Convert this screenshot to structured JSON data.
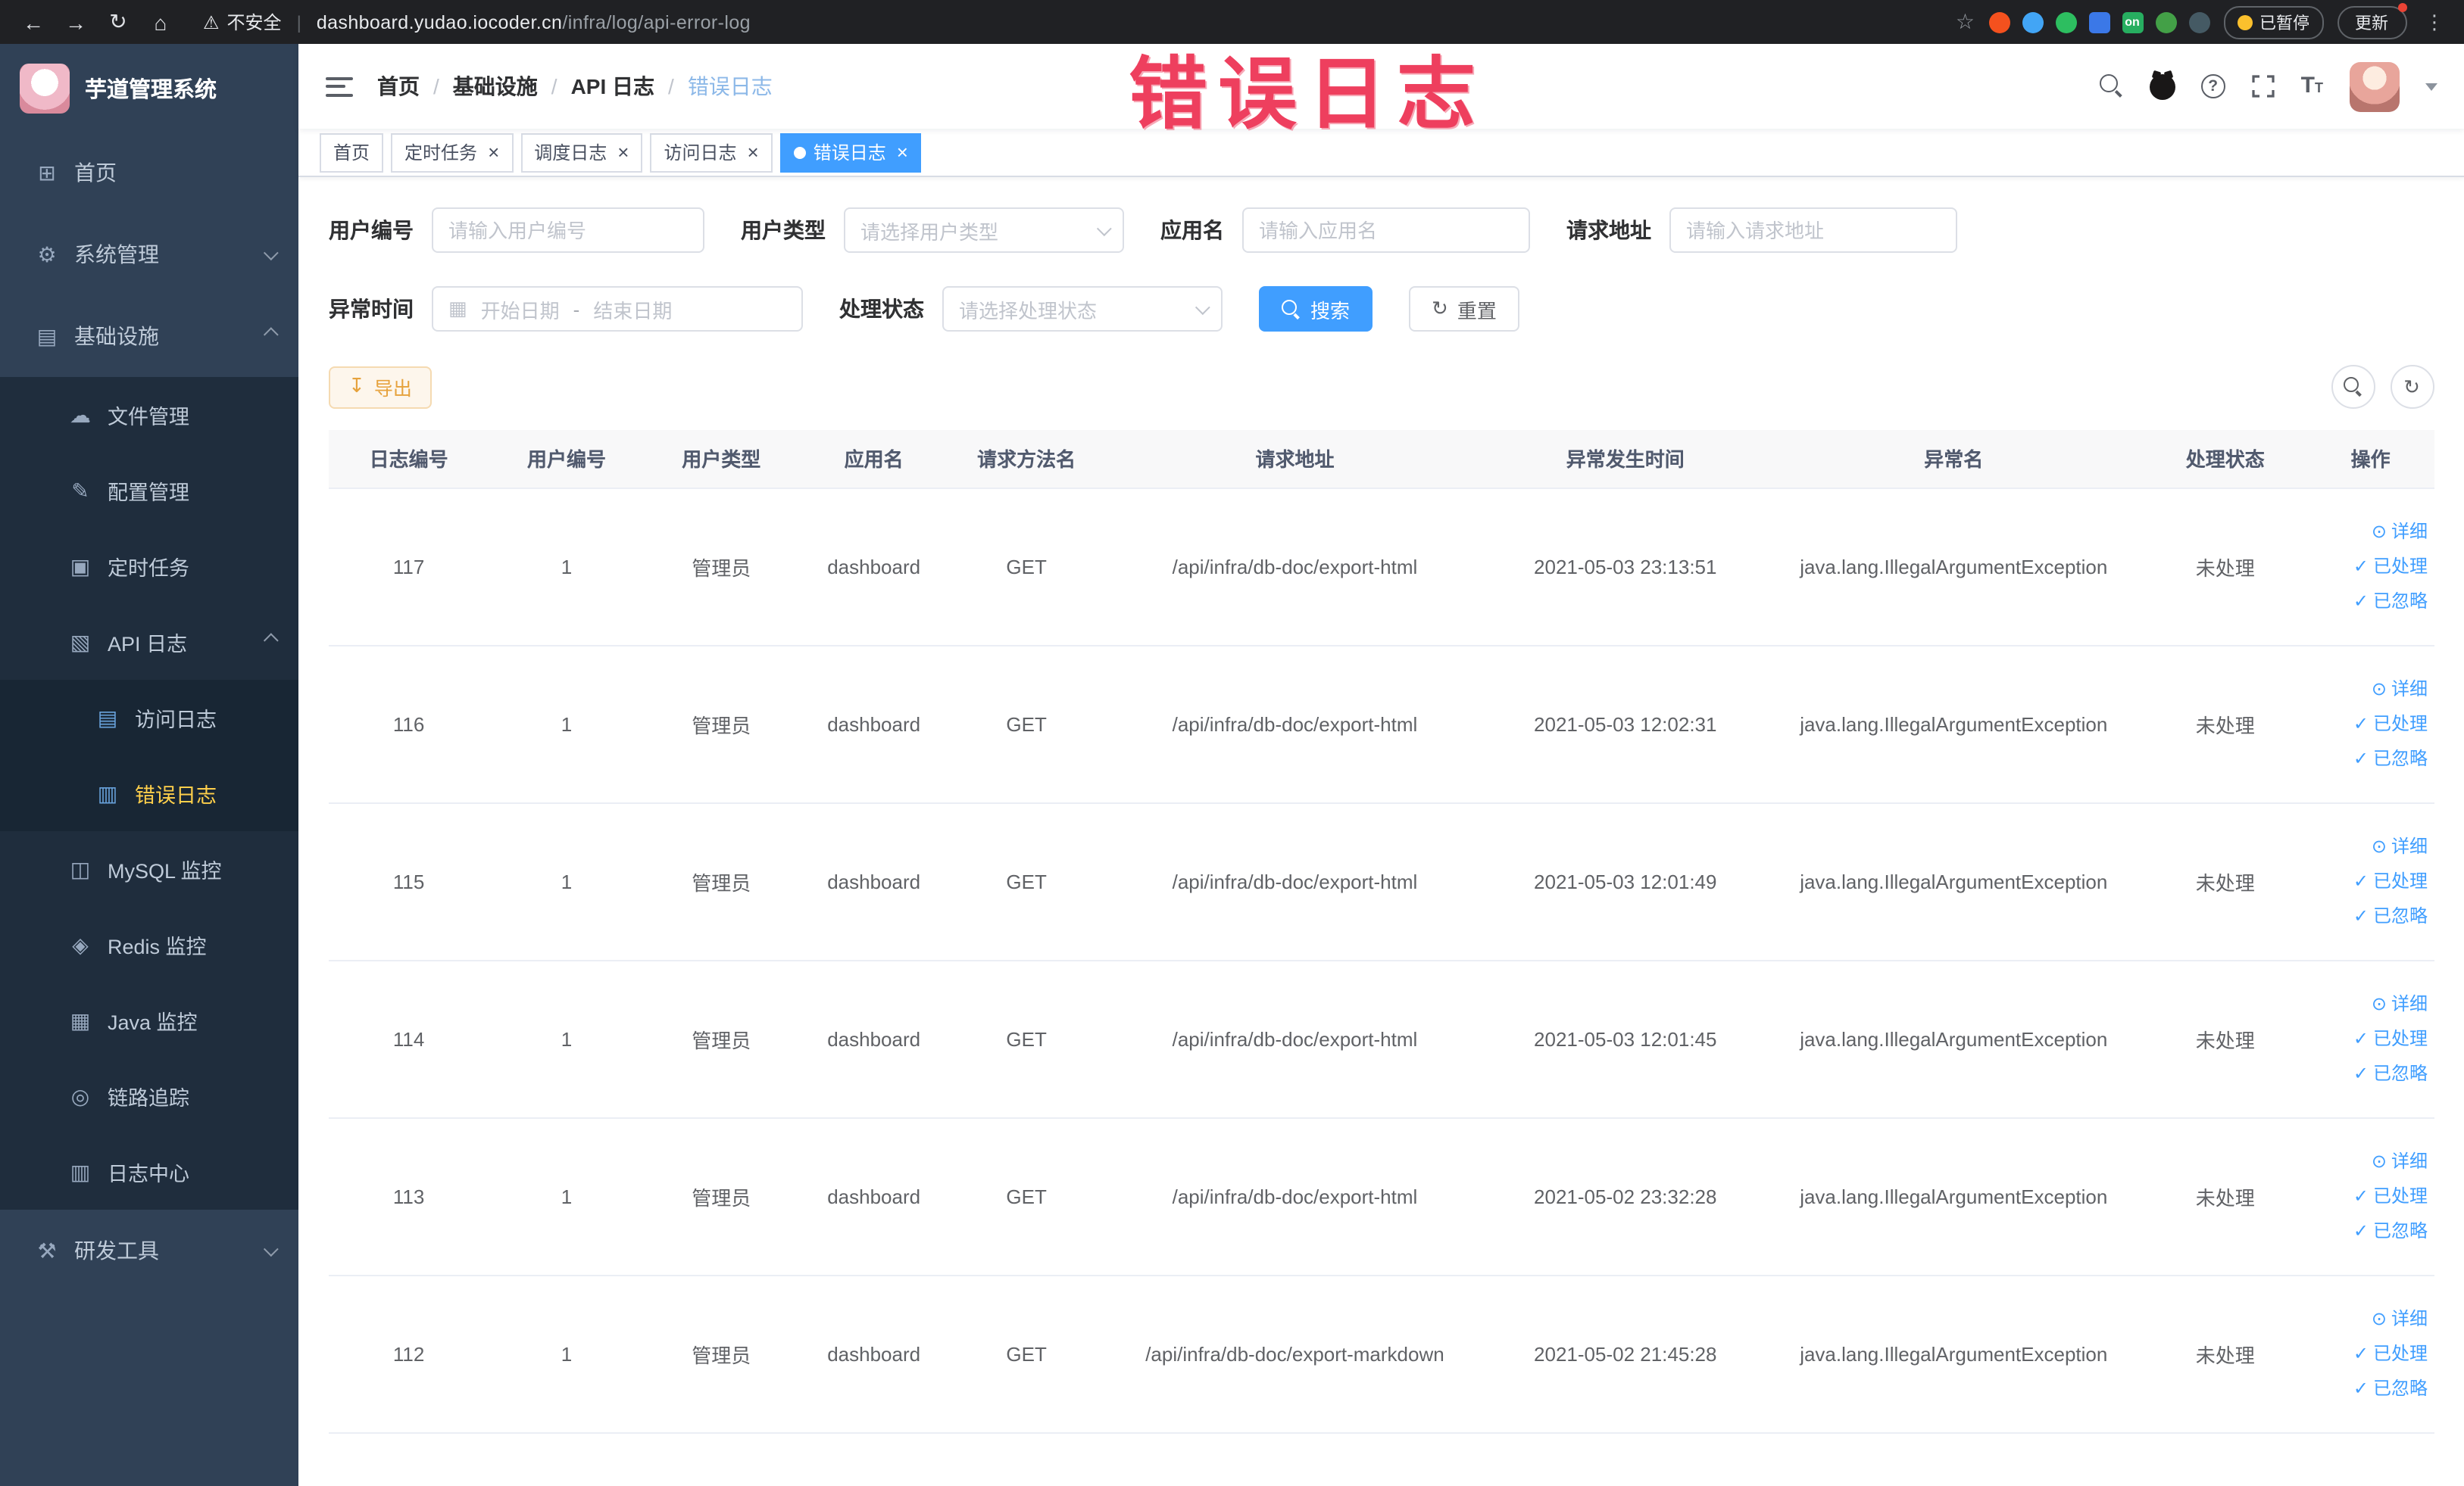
{
  "browser": {
    "icons": {
      "back": "←",
      "forward": "→",
      "reload": "↻",
      "home": "⌂",
      "bookmark": "☆",
      "warning": "⚠",
      "menu": "⋮"
    },
    "security_warning": "不安全",
    "url_domain": "dashboard.yudao.iocoder.cn",
    "url_path": "/infra/log/api-error-log",
    "extensions": [
      {
        "name": "extension-icon-orange-circle",
        "color": "#f4511e",
        "shape": "circle",
        "label": ""
      },
      {
        "name": "extension-icon-blue-drop",
        "color": "#42a5f5",
        "shape": "circle",
        "label": ""
      },
      {
        "name": "extension-icon-green-circle",
        "color": "#2dbe60",
        "shape": "circle",
        "label": ""
      },
      {
        "name": "extension-icon-blue-grid",
        "color": "#3b78e7",
        "shape": "square",
        "label": ""
      },
      {
        "name": "extension-icon-on-badge",
        "color": "#27ae60",
        "shape": "square",
        "label": "on"
      },
      {
        "name": "extension-icon-green-leaf",
        "color": "#43a047",
        "shape": "circle",
        "label": ""
      },
      {
        "name": "extension-icon-dark-paw",
        "color": "#455a64",
        "shape": "circle",
        "label": ""
      }
    ],
    "paused_badge": "已暂停",
    "update_button": "更新"
  },
  "overlay": {
    "watermark_text": "错误日志",
    "watermark_color": "#ee3f5e"
  },
  "sidebar": {
    "logo_title": "芋道管理系统",
    "items": [
      {
        "label": "首页",
        "icon": "home-icon",
        "glyph": "⊞",
        "level": 1,
        "chevron": "none",
        "active": false
      },
      {
        "label": "系统管理",
        "icon": "system-management-icon",
        "glyph": "⚙",
        "level": 1,
        "chevron": "down",
        "active": false
      },
      {
        "label": "基础设施",
        "icon": "infrastructure-icon",
        "glyph": "▤",
        "level": 1,
        "chevron": "up",
        "active": false
      },
      {
        "label": "文件管理",
        "icon": "file-management-icon",
        "glyph": "☁",
        "level": 2,
        "chevron": "none",
        "active": false
      },
      {
        "label": "配置管理",
        "icon": "config-management-icon",
        "glyph": "✎",
        "level": 2,
        "chevron": "none",
        "active": false
      },
      {
        "label": "定时任务",
        "icon": "scheduled-job-icon",
        "glyph": "▣",
        "level": 2,
        "chevron": "none",
        "active": false
      },
      {
        "label": "API 日志",
        "icon": "api-log-icon",
        "glyph": "▧",
        "level": 2,
        "chevron": "up",
        "active": false
      },
      {
        "label": "访问日志",
        "icon": "access-log-icon",
        "glyph": "▤",
        "level": 3,
        "chevron": "none",
        "active": false,
        "icon_color": "#69a3dc"
      },
      {
        "label": "错误日志",
        "icon": "error-log-icon",
        "glyph": "▥",
        "level": 3,
        "chevron": "none",
        "active": true,
        "icon_color": "#69a3dc"
      },
      {
        "label": "MySQL 监控",
        "icon": "mysql-monitor-icon",
        "glyph": "◫",
        "level": 2,
        "chevron": "none",
        "active": false
      },
      {
        "label": "Redis 监控",
        "icon": "redis-monitor-icon",
        "glyph": "◈",
        "level": 2,
        "chevron": "none",
        "active": false
      },
      {
        "label": "Java 监控",
        "icon": "java-monitor-icon",
        "glyph": "▦",
        "level": 2,
        "chevron": "none",
        "active": false
      },
      {
        "label": "链路追踪",
        "icon": "trace-icon",
        "glyph": "◎",
        "level": 2,
        "chevron": "none",
        "active": false
      },
      {
        "label": "日志中心",
        "icon": "log-center-icon",
        "glyph": "▥",
        "level": 2,
        "chevron": "none",
        "active": false
      },
      {
        "label": "研发工具",
        "icon": "dev-tools-icon",
        "glyph": "⚒",
        "level": 1,
        "chevron": "down",
        "active": false
      }
    ]
  },
  "breadcrumb": [
    "首页",
    "基础设施",
    "API 日志",
    "错误日志"
  ],
  "tabs": [
    {
      "label": "首页",
      "closable": false,
      "active": false
    },
    {
      "label": "定时任务",
      "closable": true,
      "active": false
    },
    {
      "label": "调度日志",
      "closable": true,
      "active": false
    },
    {
      "label": "访问日志",
      "closable": true,
      "active": false
    },
    {
      "label": "错误日志",
      "closable": true,
      "active": true
    }
  ],
  "tabs_close_glyph": "×",
  "filters": {
    "user_id": {
      "label": "用户编号",
      "placeholder": "请输入用户编号"
    },
    "user_type": {
      "label": "用户类型",
      "placeholder": "请选择用户类型"
    },
    "app_name": {
      "label": "应用名",
      "placeholder": "请输入应用名"
    },
    "request_url": {
      "label": "请求地址",
      "placeholder": "请输入请求地址"
    },
    "exception_time": {
      "label": "异常时间",
      "start_placeholder": "开始日期",
      "separator": "-",
      "end_placeholder": "结束日期"
    },
    "process_status": {
      "label": "处理状态",
      "placeholder": "请选择处理状态"
    },
    "search_button": "搜索",
    "reset_button": "重置"
  },
  "toolbar": {
    "export_label": "导出"
  },
  "table": {
    "columns": [
      "日志编号",
      "用户编号",
      "用户类型",
      "应用名",
      "请求方法名",
      "请求地址",
      "异常发生时间",
      "异常名",
      "处理状态",
      "操作"
    ],
    "actions": [
      {
        "key": "detail",
        "label": "详细",
        "glyph": "⊙",
        "icon": "view-detail-icon"
      },
      {
        "key": "processed",
        "label": "已处理",
        "glyph": "✓",
        "icon": "mark-processed-icon"
      },
      {
        "key": "ignored",
        "label": "已忽略",
        "glyph": "✓",
        "icon": "mark-ignored-icon"
      }
    ],
    "rows": [
      {
        "id": "117",
        "user_id": "1",
        "user_type": "管理员",
        "app": "dashboard",
        "method": "GET",
        "url": "/api/infra/db-doc/export-html",
        "time": "2021-05-03 23:13:51",
        "exception": "java.lang.IllegalArgumentException",
        "status": "未处理"
      },
      {
        "id": "116",
        "user_id": "1",
        "user_type": "管理员",
        "app": "dashboard",
        "method": "GET",
        "url": "/api/infra/db-doc/export-html",
        "time": "2021-05-03 12:02:31",
        "exception": "java.lang.IllegalArgumentException",
        "status": "未处理"
      },
      {
        "id": "115",
        "user_id": "1",
        "user_type": "管理员",
        "app": "dashboard",
        "method": "GET",
        "url": "/api/infra/db-doc/export-html",
        "time": "2021-05-03 12:01:49",
        "exception": "java.lang.IllegalArgumentException",
        "status": "未处理"
      },
      {
        "id": "114",
        "user_id": "1",
        "user_type": "管理员",
        "app": "dashboard",
        "method": "GET",
        "url": "/api/infra/db-doc/export-html",
        "time": "2021-05-03 12:01:45",
        "exception": "java.lang.IllegalArgumentException",
        "status": "未处理"
      },
      {
        "id": "113",
        "user_id": "1",
        "user_type": "管理员",
        "app": "dashboard",
        "method": "GET",
        "url": "/api/infra/db-doc/export-html",
        "time": "2021-05-02 23:32:28",
        "exception": "java.lang.IllegalArgumentException",
        "status": "未处理"
      },
      {
        "id": "112",
        "user_id": "1",
        "user_type": "管理员",
        "app": "dashboard",
        "method": "GET",
        "url": "/api/infra/db-doc/export-markdown",
        "time": "2021-05-02 21:45:28",
        "exception": "java.lang.IllegalArgumentException",
        "status": "未处理"
      }
    ]
  },
  "colors": {
    "primary": "#409eff",
    "sidebar_bg": "#304156",
    "submenu_bg": "#1f2d3d",
    "active_menu_text": "#ffd04b",
    "warning": "#e6a23c",
    "watermark_red": "#ee3f5e"
  }
}
